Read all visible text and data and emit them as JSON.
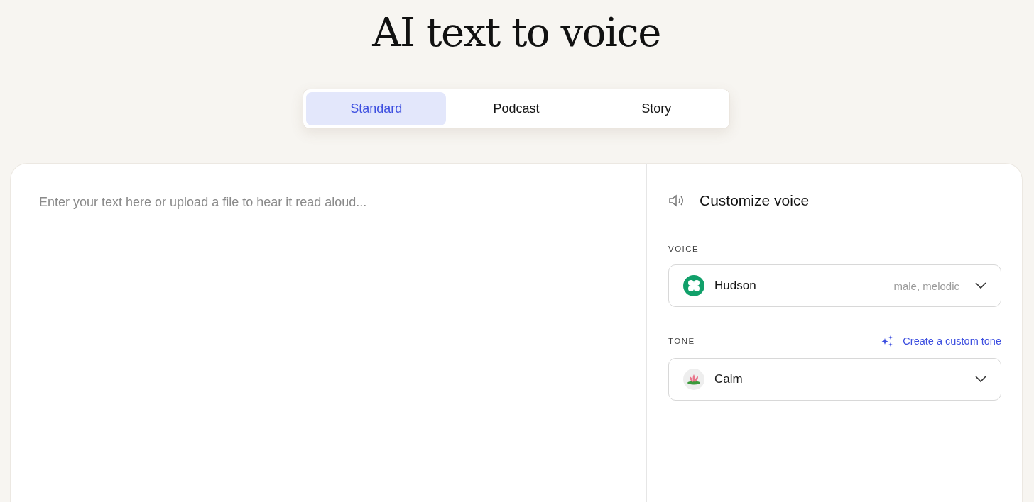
{
  "title": "AI text to voice",
  "tabs": [
    {
      "label": "Standard",
      "selected": true
    },
    {
      "label": "Podcast",
      "selected": false
    },
    {
      "label": "Story",
      "selected": false
    }
  ],
  "editor": {
    "placeholder": "Enter your text here or upload a file to hear it read aloud..."
  },
  "panel": {
    "title": "Customize voice",
    "voice": {
      "label": "VOICE",
      "name": "Hudson",
      "description": "male, melodic"
    },
    "tone": {
      "label": "TONE",
      "link": "Create a custom tone",
      "name": "Calm"
    }
  }
}
